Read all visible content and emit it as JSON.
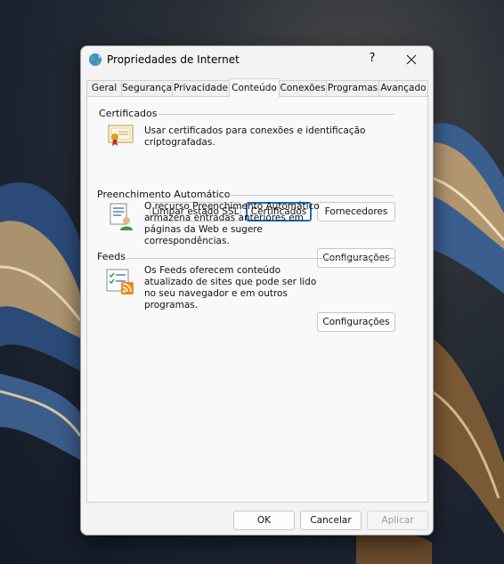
{
  "window": {
    "title": "Propriedades de Internet",
    "help_label": "?"
  },
  "tabs": [
    {
      "label": "Geral"
    },
    {
      "label": "Segurança"
    },
    {
      "label": "Privacidade"
    },
    {
      "label": "Conteúdo",
      "active": true
    },
    {
      "label": "Conexões"
    },
    {
      "label": "Programas"
    },
    {
      "label": "Avançado"
    }
  ],
  "certificates": {
    "title": "Certificados",
    "description": "Usar certificados para conexões e identificação criptografadas.",
    "buttons": {
      "clear_ssl": "Limpar estado SSL",
      "certificates": "Certificados",
      "publishers": "Fornecedores"
    }
  },
  "autocomplete": {
    "title": "Preenchimento Automático",
    "description_lines": [
      "O recurso Preenchimento Automático",
      "armazena entradas anteriores em",
      "páginas da Web e sugere",
      "correspondências."
    ],
    "settings_label": "Configurações"
  },
  "feeds": {
    "title": "Feeds",
    "description_lines": [
      "Os Feeds oferecem conteúdo",
      "atualizado de sites que pode ser lido",
      "no seu navegador e em outros",
      "programas."
    ],
    "settings_label": "Configurações"
  },
  "footer": {
    "ok": "OK",
    "cancel": "Cancelar",
    "apply": "Aplicar"
  },
  "colors": {
    "accent": "#1b6ec2",
    "dialog_bg": "#f3f3f3"
  }
}
